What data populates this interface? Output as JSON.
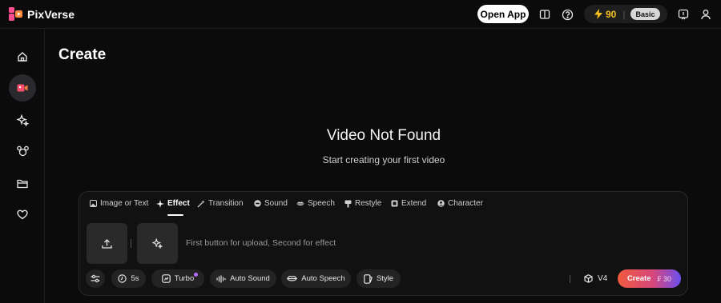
{
  "app": {
    "name": "PixVerse"
  },
  "header": {
    "open_app_label": "Open App",
    "credits": "90",
    "credits_separator": "|",
    "plan_badge": "Basic",
    "icons": [
      "book-icon",
      "help-icon",
      "lightning-icon",
      "info-badge-icon",
      "user-icon"
    ]
  },
  "sidebar": {
    "items": [
      {
        "name": "home",
        "icon": "home-icon",
        "active": false
      },
      {
        "name": "create",
        "icon": "video-camera-icon",
        "active": true
      },
      {
        "name": "effects",
        "icon": "sparkle-icon",
        "active": false
      },
      {
        "name": "characters",
        "icon": "mickey-icon",
        "active": false
      },
      {
        "name": "folder",
        "icon": "folder-icon",
        "active": false
      },
      {
        "name": "favorites",
        "icon": "heart-icon",
        "active": false
      }
    ]
  },
  "main": {
    "title": "Create",
    "empty_title": "Video Not Found",
    "empty_subtitle": "Start creating your first video"
  },
  "panel": {
    "tabs": [
      {
        "label": "Image or Text",
        "icon": "image-icon",
        "active": false
      },
      {
        "label": "Effect",
        "icon": "sparkle-icon",
        "active": true
      },
      {
        "label": "Transition",
        "icon": "wand-icon",
        "active": false
      },
      {
        "label": "Sound",
        "icon": "sound-icon",
        "active": false
      },
      {
        "label": "Speech",
        "icon": "lips-icon",
        "active": false
      },
      {
        "label": "Restyle",
        "icon": "brush-icon",
        "active": false
      },
      {
        "label": "Extend",
        "icon": "extend-icon",
        "active": false
      },
      {
        "label": "Character",
        "icon": "character-icon",
        "active": false
      }
    ],
    "upload_separator": "|",
    "hint": "First button for upload, Second for effect",
    "options": {
      "duration": "5s",
      "turbo": "Turbo",
      "auto_sound": "Auto Sound",
      "auto_speech": "Auto Speech",
      "style": "Style"
    },
    "model": "V4",
    "create_label": "Create",
    "create_cost": "30",
    "create_cost_prefix": "₣",
    "colors": {
      "accent_start": "#f05b3e",
      "accent_end": "#6b4ef0",
      "credits": "#f4c21b",
      "turbo_dot": "#b36bff"
    }
  }
}
